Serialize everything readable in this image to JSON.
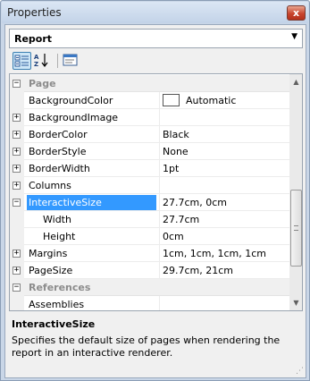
{
  "window": {
    "title": "Properties",
    "close_label": "x"
  },
  "object_selector": {
    "value": "Report"
  },
  "toolbar": {
    "buttons": [
      {
        "name": "categorized",
        "icon": "categorized-icon",
        "active": true
      },
      {
        "name": "alphabetical",
        "icon": "sort-az-icon",
        "active": false
      },
      {
        "name": "property-pages",
        "icon": "property-pages-icon",
        "active": false
      }
    ]
  },
  "grid": {
    "rows": [
      {
        "type": "category",
        "toggle": "−",
        "name": "Page",
        "value": ""
      },
      {
        "type": "property",
        "toggle": "",
        "name": "BackgroundColor",
        "value": "Automatic",
        "swatch": "#ffffff"
      },
      {
        "type": "property",
        "toggle": "+",
        "name": "BackgroundImage",
        "value": ""
      },
      {
        "type": "property",
        "toggle": "+",
        "name": "BorderColor",
        "value": "Black"
      },
      {
        "type": "property",
        "toggle": "+",
        "name": "BorderStyle",
        "value": "None"
      },
      {
        "type": "property",
        "toggle": "+",
        "name": "BorderWidth",
        "value": "1pt"
      },
      {
        "type": "property",
        "toggle": "+",
        "name": "Columns",
        "value": ""
      },
      {
        "type": "property",
        "toggle": "−",
        "name": "InteractiveSize",
        "value": "27.7cm, 0cm",
        "selected": true
      },
      {
        "type": "child",
        "toggle": "",
        "name": "Width",
        "value": "27.7cm"
      },
      {
        "type": "child",
        "toggle": "",
        "name": "Height",
        "value": "0cm"
      },
      {
        "type": "property",
        "toggle": "+",
        "name": "Margins",
        "value": "1cm, 1cm, 1cm, 1cm"
      },
      {
        "type": "property",
        "toggle": "+",
        "name": "PageSize",
        "value": "29.7cm, 21cm"
      },
      {
        "type": "category",
        "toggle": "−",
        "name": "References",
        "value": ""
      },
      {
        "type": "property",
        "toggle": "",
        "name": "Assemblies",
        "value": ""
      }
    ]
  },
  "help": {
    "title": "InteractiveSize",
    "description": "Specifies the default size of pages when rendering the report in an interactive renderer."
  },
  "colors": {
    "selection": "#3399ff",
    "close_button": "#c8452e",
    "category_text": "#8c8c8c"
  }
}
